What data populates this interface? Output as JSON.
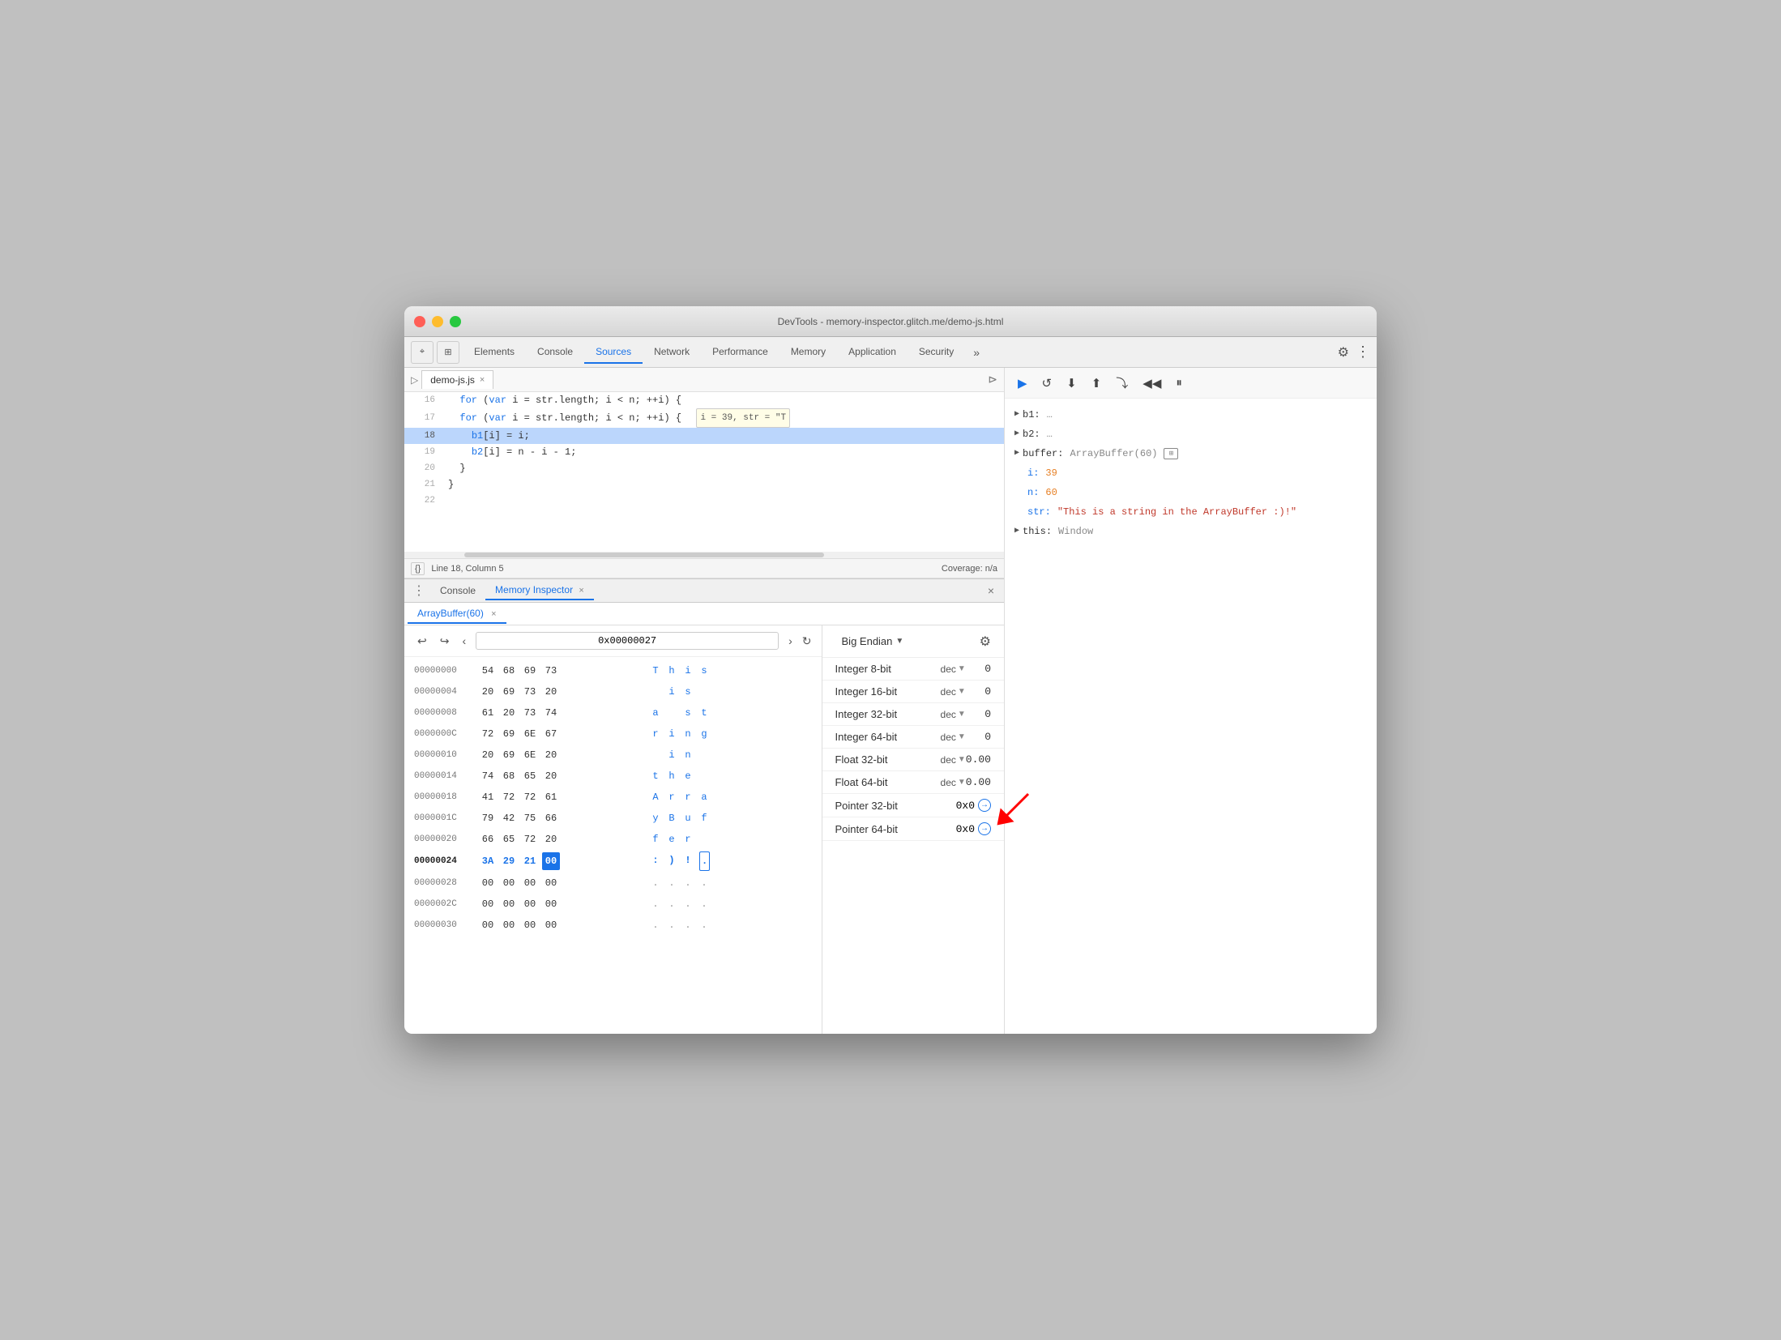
{
  "window": {
    "title": "DevTools - memory-inspector.glitch.me/demo-js.html"
  },
  "tabs": {
    "items": [
      "Elements",
      "Console",
      "Sources",
      "Network",
      "Performance",
      "Memory",
      "Application",
      "Security"
    ],
    "active": "Sources",
    "more_label": "»"
  },
  "source_file": {
    "name": "demo-js.js",
    "lines": [
      {
        "num": "16",
        "content": "  for (var i = str.length; i < n; ++i) {",
        "extra": "  i = 39, str = \"T",
        "highlighted": false
      },
      {
        "num": "17",
        "content": "  for (var i = str.length; i < n; ++i) {",
        "extra": "",
        "highlighted": false
      },
      {
        "num": "18",
        "content": "    b1[i] = i;",
        "extra": "",
        "highlighted": true
      },
      {
        "num": "19",
        "content": "    b2[i] = n - i - 1;",
        "extra": "",
        "highlighted": false
      },
      {
        "num": "20",
        "content": "  }",
        "extra": "",
        "highlighted": false
      },
      {
        "num": "21",
        "content": "}",
        "extra": "",
        "highlighted": false
      },
      {
        "num": "22",
        "content": "",
        "extra": "",
        "highlighted": false
      }
    ]
  },
  "status_bar": {
    "brace_icon": "{}",
    "position": "Line 18, Column 5",
    "coverage": "Coverage: n/a"
  },
  "bottom_tabs": {
    "console_label": "Console",
    "memory_inspector_label": "Memory Inspector",
    "active": "Memory Inspector"
  },
  "memory_inspector": {
    "subtab_label": "ArrayBuffer(60)",
    "address": "0x00000027",
    "nav_prev": "‹",
    "nav_next": "›",
    "refresh_icon": "↻",
    "back_icon": "↩",
    "forward_icon": "↪",
    "rows": [
      {
        "addr": "00000000",
        "bytes": [
          "54",
          "68",
          "69",
          "73"
        ],
        "ascii": [
          "T",
          "h",
          "i",
          "s"
        ],
        "selected": []
      },
      {
        "addr": "00000004",
        "bytes": [
          "20",
          "69",
          "73",
          "20"
        ],
        "ascii": [
          "i",
          "s",
          "",
          ""
        ],
        "selected": []
      },
      {
        "addr": "00000008",
        "bytes": [
          "61",
          "20",
          "73",
          "74"
        ],
        "ascii": [
          "a",
          "s",
          "t",
          ""
        ],
        "selected": []
      },
      {
        "addr": "0000000C",
        "bytes": [
          "72",
          "69",
          "6E",
          "67"
        ],
        "ascii": [
          "r",
          "i",
          "n",
          "g"
        ],
        "selected": []
      },
      {
        "addr": "00000010",
        "bytes": [
          "20",
          "69",
          "6E",
          "20"
        ],
        "ascii": [
          "i",
          "n",
          "",
          ""
        ],
        "selected": []
      },
      {
        "addr": "00000014",
        "bytes": [
          "74",
          "68",
          "65",
          "20"
        ],
        "ascii": [
          "t",
          "h",
          "e",
          ""
        ],
        "selected": []
      },
      {
        "addr": "00000018",
        "bytes": [
          "41",
          "72",
          "72",
          "61"
        ],
        "ascii": [
          "A",
          "r",
          "r",
          "a"
        ],
        "selected": []
      },
      {
        "addr": "0000001C",
        "bytes": [
          "79",
          "42",
          "75",
          "66"
        ],
        "ascii": [
          "y",
          "B",
          "u",
          "f"
        ],
        "selected": []
      },
      {
        "addr": "00000020",
        "bytes": [
          "66",
          "65",
          "72",
          "20"
        ],
        "ascii": [
          "f",
          "e",
          "r",
          ""
        ],
        "selected": []
      },
      {
        "addr": "00000024",
        "bytes": [
          "3A",
          "29",
          "21",
          "00"
        ],
        "ascii": [
          ":",
          ")",
          "!",
          "."
        ],
        "selected": [
          3
        ],
        "highlighted": true
      },
      {
        "addr": "00000028",
        "bytes": [
          "00",
          "00",
          "00",
          "00"
        ],
        "ascii": [
          ".",
          ".",
          ".",
          "."
        ],
        "selected": []
      },
      {
        "addr": "0000002C",
        "bytes": [
          "00",
          "00",
          "00",
          "00"
        ],
        "ascii": [
          ".",
          ".",
          ".",
          "."
        ],
        "selected": []
      },
      {
        "addr": "00000030",
        "bytes": [
          "00",
          "00",
          "00",
          "00"
        ],
        "ascii": [
          ".",
          ".",
          ".",
          "."
        ],
        "selected": []
      }
    ],
    "endian": "Big Endian",
    "values": [
      {
        "label": "Integer 8-bit",
        "format": "dec",
        "value": "0",
        "type": "int"
      },
      {
        "label": "Integer 16-bit",
        "format": "dec",
        "value": "0",
        "type": "int"
      },
      {
        "label": "Integer 32-bit",
        "format": "dec",
        "value": "0",
        "type": "int"
      },
      {
        "label": "Integer 64-bit",
        "format": "dec",
        "value": "0",
        "type": "int"
      },
      {
        "label": "Float 32-bit",
        "format": "dec",
        "value": "0.00",
        "type": "float"
      },
      {
        "label": "Float 64-bit",
        "format": "dec",
        "value": "0.00",
        "type": "float"
      },
      {
        "label": "Pointer 32-bit",
        "format": "",
        "value": "0x0",
        "type": "pointer"
      },
      {
        "label": "Pointer 64-bit",
        "format": "",
        "value": "0x0",
        "type": "pointer"
      }
    ]
  },
  "debugger": {
    "toolbar_icons": [
      "▶",
      "⏸",
      "⬇",
      "⬆",
      "⤵",
      "◀◀",
      "⏸"
    ],
    "scope": [
      {
        "key": "b1:",
        "val": "…",
        "arrow": true,
        "indent": 0
      },
      {
        "key": "b2:",
        "val": "…",
        "arrow": true,
        "indent": 0
      },
      {
        "key": "buffer:",
        "val": "ArrayBuffer(60)",
        "arrow": true,
        "indent": 0,
        "has_buffer_icon": true
      },
      {
        "key": "i:",
        "val": "39",
        "arrow": false,
        "indent": 0,
        "val_color": "orange"
      },
      {
        "key": "n:",
        "val": "60",
        "arrow": false,
        "indent": 0,
        "val_color": "orange"
      },
      {
        "key": "str:",
        "val": "\"This is a string in the ArrayBuffer :)!\"",
        "arrow": false,
        "indent": 0,
        "val_color": "red"
      },
      {
        "key": "this:",
        "val": "Window",
        "arrow": true,
        "indent": 0
      }
    ]
  },
  "icons": {
    "cursor": "⌖",
    "layers": "⊞",
    "gear": "⚙",
    "pause": "⏸",
    "play": "▶",
    "step_over": "↷",
    "step_into": "↓",
    "step_out": "↑",
    "resume": "►"
  }
}
